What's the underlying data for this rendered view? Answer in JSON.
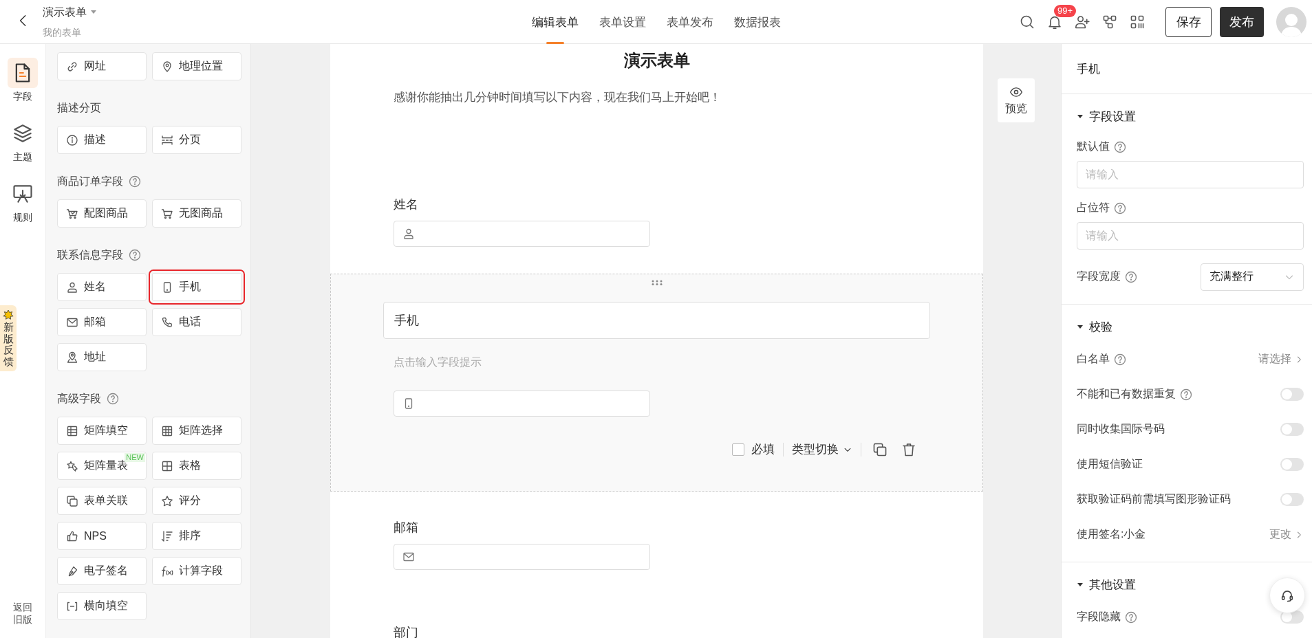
{
  "header": {
    "title": "演示表单",
    "subtitle": "我的表单",
    "tabs": [
      {
        "label": "编辑表单",
        "selected": true
      },
      {
        "label": "表单设置",
        "selected": false
      },
      {
        "label": "表单发布",
        "selected": false
      },
      {
        "label": "数据报表",
        "selected": false
      }
    ],
    "notification_badge": "99+",
    "save": "保存",
    "publish": "发布"
  },
  "rail": {
    "items": [
      {
        "label": "字段",
        "kind": "fields",
        "selected": true
      },
      {
        "label": "主题",
        "kind": "theme",
        "selected": false
      },
      {
        "label": "规则",
        "kind": "rules",
        "selected": false
      }
    ],
    "feedback": "新版反馈",
    "back": "返回旧版"
  },
  "field_panel": {
    "sections": [
      {
        "items": [
          {
            "label": "网址",
            "kind": "url"
          },
          {
            "label": "地理位置",
            "kind": "location"
          }
        ]
      },
      {
        "title": "描述分页",
        "help": false,
        "items": [
          {
            "label": "描述",
            "kind": "description"
          },
          {
            "label": "分页",
            "kind": "pagination"
          }
        ]
      },
      {
        "title": "商品订单字段",
        "help": true,
        "items": [
          {
            "label": "配图商品",
            "kind": "product-image"
          },
          {
            "label": "无图商品",
            "kind": "product"
          }
        ]
      },
      {
        "title": "联系信息字段",
        "help": true,
        "items": [
          {
            "label": "姓名",
            "kind": "name"
          },
          {
            "label": "手机",
            "kind": "phone",
            "highlighted": true
          },
          {
            "label": "邮箱",
            "kind": "email"
          },
          {
            "label": "电话",
            "kind": "telephone"
          },
          {
            "label": "地址",
            "kind": "address"
          }
        ]
      },
      {
        "title": "高级字段",
        "help": true,
        "items": [
          {
            "label": "矩阵填空",
            "kind": "matrix-fill"
          },
          {
            "label": "矩阵选择",
            "kind": "matrix-choice"
          },
          {
            "label": "矩阵量表",
            "kind": "matrix-scale",
            "badge": "NEW"
          },
          {
            "label": "表格",
            "kind": "table"
          },
          {
            "label": "表单关联",
            "kind": "form-link"
          },
          {
            "label": "评分",
            "kind": "rating"
          },
          {
            "label": "NPS",
            "kind": "nps"
          },
          {
            "label": "排序",
            "kind": "ranking"
          },
          {
            "label": "电子签名",
            "kind": "signature"
          },
          {
            "label": "计算字段",
            "kind": "formula"
          },
          {
            "label": "横向填空",
            "kind": "inline-fill"
          }
        ]
      }
    ]
  },
  "form": {
    "title": "演示表单",
    "description": "感谢你能抽出几分钟时间填写以下内容，现在我们马上开始吧！",
    "preview": "预览",
    "fields": [
      {
        "label": "姓名",
        "kind": "name",
        "selected": false
      },
      {
        "label": "手机",
        "kind": "phone",
        "selected": true,
        "hint": "点击输入字段提示",
        "required": false,
        "required_label": "必填",
        "type_switch": "类型切换"
      },
      {
        "label": "邮箱",
        "kind": "email",
        "selected": false
      },
      {
        "label": "部门",
        "kind": "text",
        "selected": false
      }
    ]
  },
  "settings": {
    "title": "手机",
    "sections": [
      {
        "title": "字段设置",
        "expanded": true,
        "rows": [
          {
            "kind": "input",
            "label": "默认值",
            "help": true,
            "placeholder": "请输入"
          },
          {
            "kind": "input",
            "label": "占位符",
            "help": true,
            "placeholder": "请输入"
          },
          {
            "kind": "select",
            "label": "字段宽度",
            "help": true,
            "value": "充满整行"
          }
        ]
      },
      {
        "title": "校验",
        "expanded": true,
        "rows": [
          {
            "kind": "link",
            "label": "白名单",
            "help": true,
            "value": "请选择"
          },
          {
            "kind": "toggle",
            "label": "不能和已有数据重复",
            "help": true,
            "on": false
          },
          {
            "kind": "toggle",
            "label": "同时收集国际号码",
            "help": false,
            "on": false
          },
          {
            "kind": "toggle",
            "label": "使用短信验证",
            "help": false,
            "on": false
          },
          {
            "kind": "toggle",
            "label": "获取验证码前需填写图形验证码",
            "help": false,
            "on": false
          },
          {
            "kind": "link",
            "label": "使用签名:小金",
            "help": false,
            "value": "更改"
          }
        ]
      },
      {
        "title": "其他设置",
        "expanded": true,
        "rows": [
          {
            "kind": "toggle",
            "label": "字段隐藏",
            "help": true,
            "on": false
          }
        ]
      }
    ]
  }
}
